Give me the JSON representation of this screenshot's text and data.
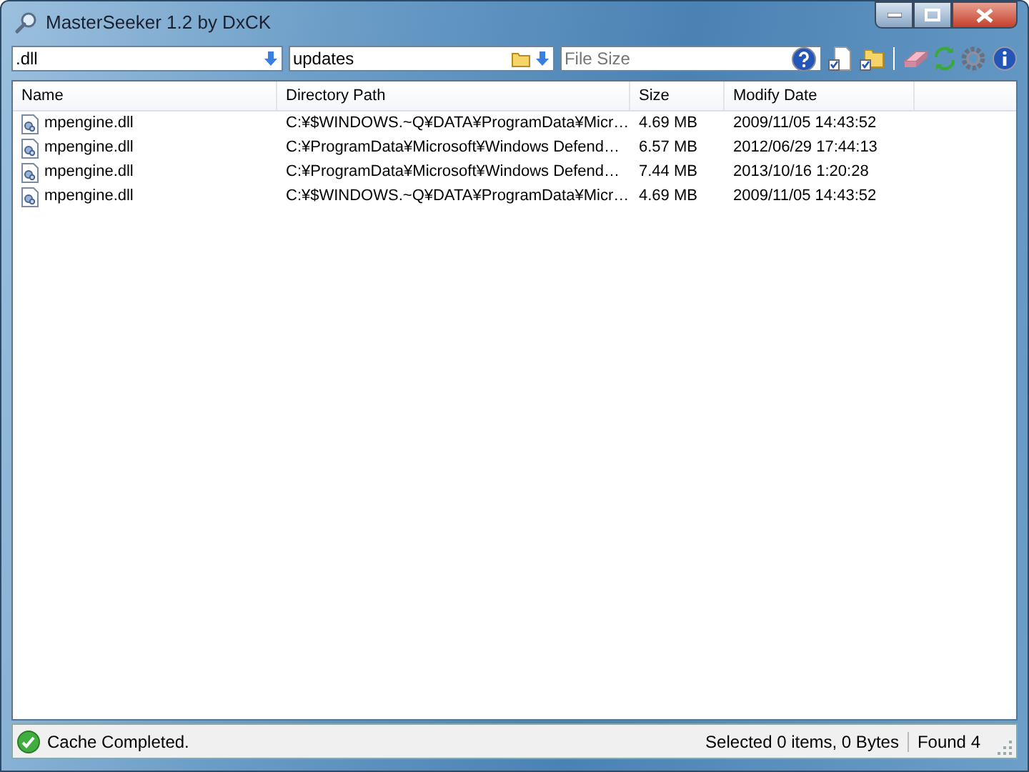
{
  "window": {
    "title": "MasterSeeker 1.2 by DxCK"
  },
  "search": {
    "name_filter": ".dll",
    "path_filter": "updates",
    "size_placeholder": "File Size"
  },
  "table": {
    "columns": [
      "Name",
      "Directory Path",
      "Size",
      "Modify Date"
    ],
    "rows": [
      {
        "name": "mpengine.dll",
        "path": "C:¥$WINDOWS.~Q¥DATA¥ProgramData¥Micr…",
        "size": "4.69 MB",
        "date": "2009/11/05 14:43:52"
      },
      {
        "name": "mpengine.dll",
        "path": "C:¥ProgramData¥Microsoft¥Windows Defend…",
        "size": "6.57 MB",
        "date": "2012/06/29 17:44:13"
      },
      {
        "name": "mpengine.dll",
        "path": "C:¥ProgramData¥Microsoft¥Windows Defend…",
        "size": "7.44 MB",
        "date": "2013/10/16 1:20:28"
      },
      {
        "name": "mpengine.dll",
        "path": "C:¥$WINDOWS.~Q¥DATA¥ProgramData¥Micr…",
        "size": "4.69 MB",
        "date": "2009/11/05 14:43:52"
      }
    ]
  },
  "status_bar": {
    "message": "Cache Completed.",
    "selection": "Selected 0 items, 0 Bytes",
    "found": "Found 4"
  }
}
